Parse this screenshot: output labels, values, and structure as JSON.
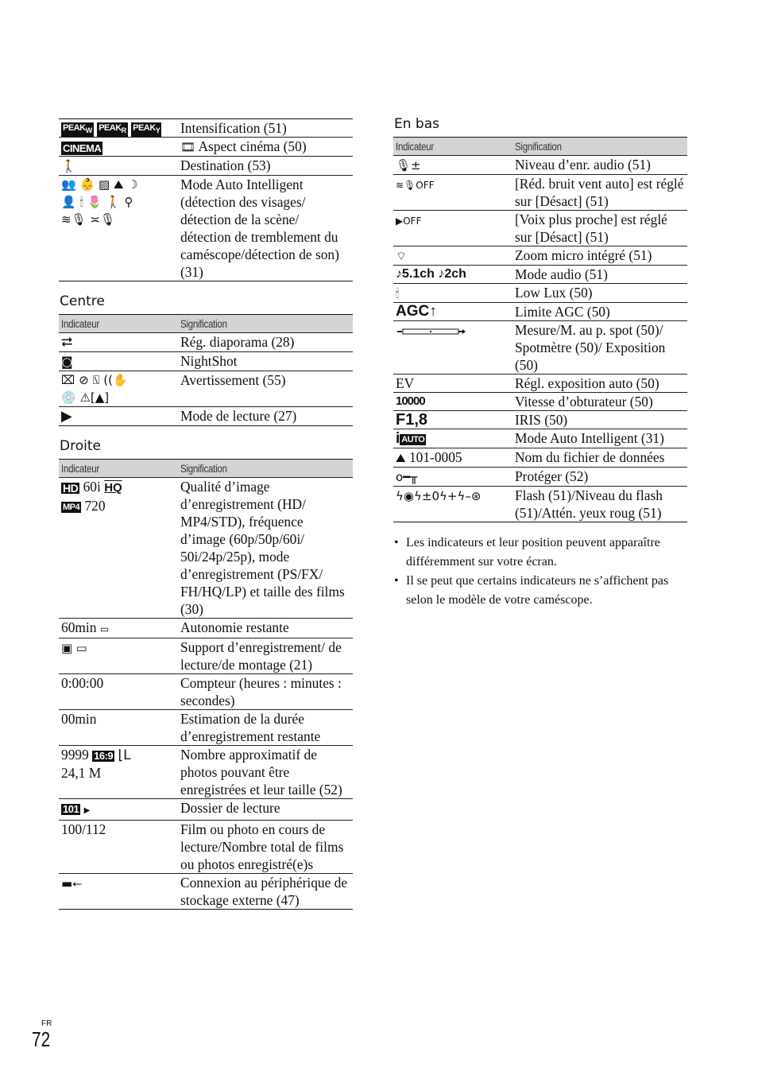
{
  "left_top_table": {
    "rows": [
      {
        "indicator": "PEAK W  PEAK R  PEAK Y",
        "icons": [
          "peak-white-icon",
          "peak-red-icon",
          "peak-yellow-icon"
        ],
        "meaning": "Intensification (51)"
      },
      {
        "indicator": "CINEMA",
        "icons": [
          "cinema-icon"
        ],
        "meaning": "Aspect cinéma (50)",
        "meaning_icon": "film-frame-icon"
      },
      {
        "indicator": "",
        "icons": [
          "destination-traveler-icon"
        ],
        "meaning": "Destination (53)"
      },
      {
        "indicator": "",
        "icons": [
          "portrait-icon",
          "baby-icon",
          "backlight-icon",
          "landscape-icon",
          "night-scene-icon",
          "spotlight-icon",
          "low-light-icon",
          "macro-icon",
          "walking-icon",
          "tripod-icon",
          "wind-mic-icon",
          "audio-mic-icon"
        ],
        "meaning": "Mode Auto Intelligent (détection des visages/ détection de la scène/ détection de tremblement du caméscope/détection de son) (31)"
      }
    ]
  },
  "sections": {
    "centre": {
      "title": "Centre",
      "header": {
        "indicator": "Indicateur",
        "meaning": "Signification"
      },
      "rows": [
        {
          "icons": [
            "slideshow-repeat-icon"
          ],
          "meaning": "Rég. diaporama (28)"
        },
        {
          "icons": [
            "nightshot-icon"
          ],
          "meaning": "NightShot"
        },
        {
          "icons": [
            "battery-warning-icon",
            "media-warning-icon",
            "card-warning-icon",
            "camera-shake-warning-icon",
            "disc-warning-icon",
            "alert-icon",
            "memory-card-eject-icon"
          ],
          "meaning": "Avertissement (55)"
        },
        {
          "icons": [
            "play-icon"
          ],
          "meaning": "Mode de lecture (27)"
        }
      ]
    },
    "droite": {
      "title": "Droite",
      "header": {
        "indicator": "Indicateur",
        "meaning": "Signification"
      },
      "rows": [
        {
          "indicator_parts": [
            "HD",
            "60i",
            "HQ",
            "MP4",
            "720"
          ],
          "meaning": "Qualité d’image d’enregistrement (HD/ MP4/STD), fréquence d’image (60p/50p/60i/ 50i/24p/25p), mode d’enregistrement (PS/FX/ FH/HQ/LP) et taille des films (30)"
        },
        {
          "indicator": "60min",
          "icons": [
            "battery-level-icon"
          ],
          "meaning": "Autonomie restante"
        },
        {
          "icons": [
            "internal-memory-icon",
            "memory-card-icon"
          ],
          "meaning": "Support d’enregistrement/ de lecture/de montage (21)"
        },
        {
          "indicator": "0:00:00",
          "meaning": "Compteur (heures : minutes : secondes)"
        },
        {
          "indicator": "00min",
          "meaning": "Estimation de la durée d’enregistrement restante"
        },
        {
          "indicator": "9999",
          "badge": "16:9",
          "indicator2": "24,1 M",
          "icons": [
            "image-size-large-icon"
          ],
          "meaning": "Nombre approximatif de photos pouvant être enregistrées et leur taille (52)"
        },
        {
          "badge": "101",
          "icons": [
            "playback-folder-icon"
          ],
          "meaning": "Dossier de lecture"
        },
        {
          "indicator": "100/112",
          "meaning": "Film ou photo en cours de lecture/Nombre total de films ou photos enregistré(e)s"
        },
        {
          "icons": [
            "usb-storage-icon"
          ],
          "meaning": "Connexion au périphérique de stockage externe (47)"
        }
      ]
    },
    "en_bas": {
      "title": "En bas",
      "header": {
        "indicator": "Indicateur",
        "meaning": "Signification"
      },
      "rows": [
        {
          "icons": [
            "mic-level-icon"
          ],
          "meaning": "Niveau d’enr. audio (51)"
        },
        {
          "icons": [
            "wind-noise-off-icon"
          ],
          "meaning": "[Réd. bruit vent auto] est réglé sur [Désact] (51)"
        },
        {
          "icons": [
            "closer-voice-off-icon"
          ],
          "meaning": "[Voix plus proche] est réglé sur [Désact] (51)"
        },
        {
          "icons": [
            "zoom-mic-icon"
          ],
          "meaning": "Zoom micro intégré (51)"
        },
        {
          "indicator": "♪5.1ch ♪2ch",
          "meaning": "Mode audio (51)"
        },
        {
          "icons": [
            "low-lux-icon"
          ],
          "meaning": "Low Lux (50)"
        },
        {
          "indicator": "AGC↑",
          "meaning": "Limite AGC (50)"
        },
        {
          "icons": [
            "meter-scale-icon"
          ],
          "meaning": "Mesure/M. au p. spot (50)/ Spotmètre (50)/ Exposition (50)"
        },
        {
          "indicator": "EV",
          "meaning": "Régl. exposition auto (50)"
        },
        {
          "indicator": "10000",
          "meaning": "Vitesse d’obturateur (50)"
        },
        {
          "indicator": "F1,8",
          "meaning": "IRIS (50)"
        },
        {
          "indicator": "i",
          "badge": "AUTO",
          "meaning": "Mode Auto Intelligent (31)"
        },
        {
          "indicator": "101-0005",
          "icons": [
            "photo-file-icon"
          ],
          "meaning": "Nom du fichier de données"
        },
        {
          "icons": [
            "protect-key-icon"
          ],
          "meaning": "Protéger (52)"
        },
        {
          "icons": [
            "flash-icon",
            "red-eye-icon",
            "flash-level-0-icon",
            "flash-plus-icon",
            "flash-minus-icon",
            "flash-off-icon"
          ],
          "meaning": "Flash (51)/Niveau du flash (51)/Attén. yeux roug (51)"
        }
      ],
      "notes": [
        "Les indicateurs et leur position peuvent apparaître différemment sur votre écran.",
        "Il se peut que certains indicateurs ne s’affichent pas selon le modèle de votre caméscope."
      ]
    }
  },
  "footer": {
    "lang": "FR",
    "page": "72"
  }
}
